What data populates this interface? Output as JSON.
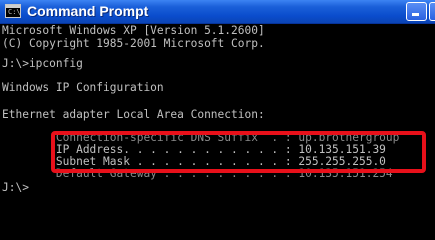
{
  "window": {
    "title": "Command Prompt",
    "icon": "cmd-icon",
    "icon_glyph": "C:\\",
    "controls": [
      "minimize-icon",
      "maximize-icon"
    ]
  },
  "console": {
    "lines": [
      "Microsoft Windows XP [Version 5.1.2600]",
      "(C) Copyright 1985-2001 Microsoft Corp.",
      "",
      "J:\\>ipconfig",
      "",
      "Windows IP Configuration",
      "",
      "",
      "Ethernet adapter Local Area Connection:",
      "",
      "        Connection-specific DNS Suffix  . : up.brothergroup",
      "        IP Address. . . . . . . . . . . . : 10.135.151.39",
      "        Subnet Mask . . . . . . . . . . . : 255.255.255.0",
      "        Default Gateway . . . . . . . . . : 10.135.151.254",
      "",
      "J:\\>"
    ]
  },
  "annotation": {
    "highlight_color": "#e8101a"
  }
}
